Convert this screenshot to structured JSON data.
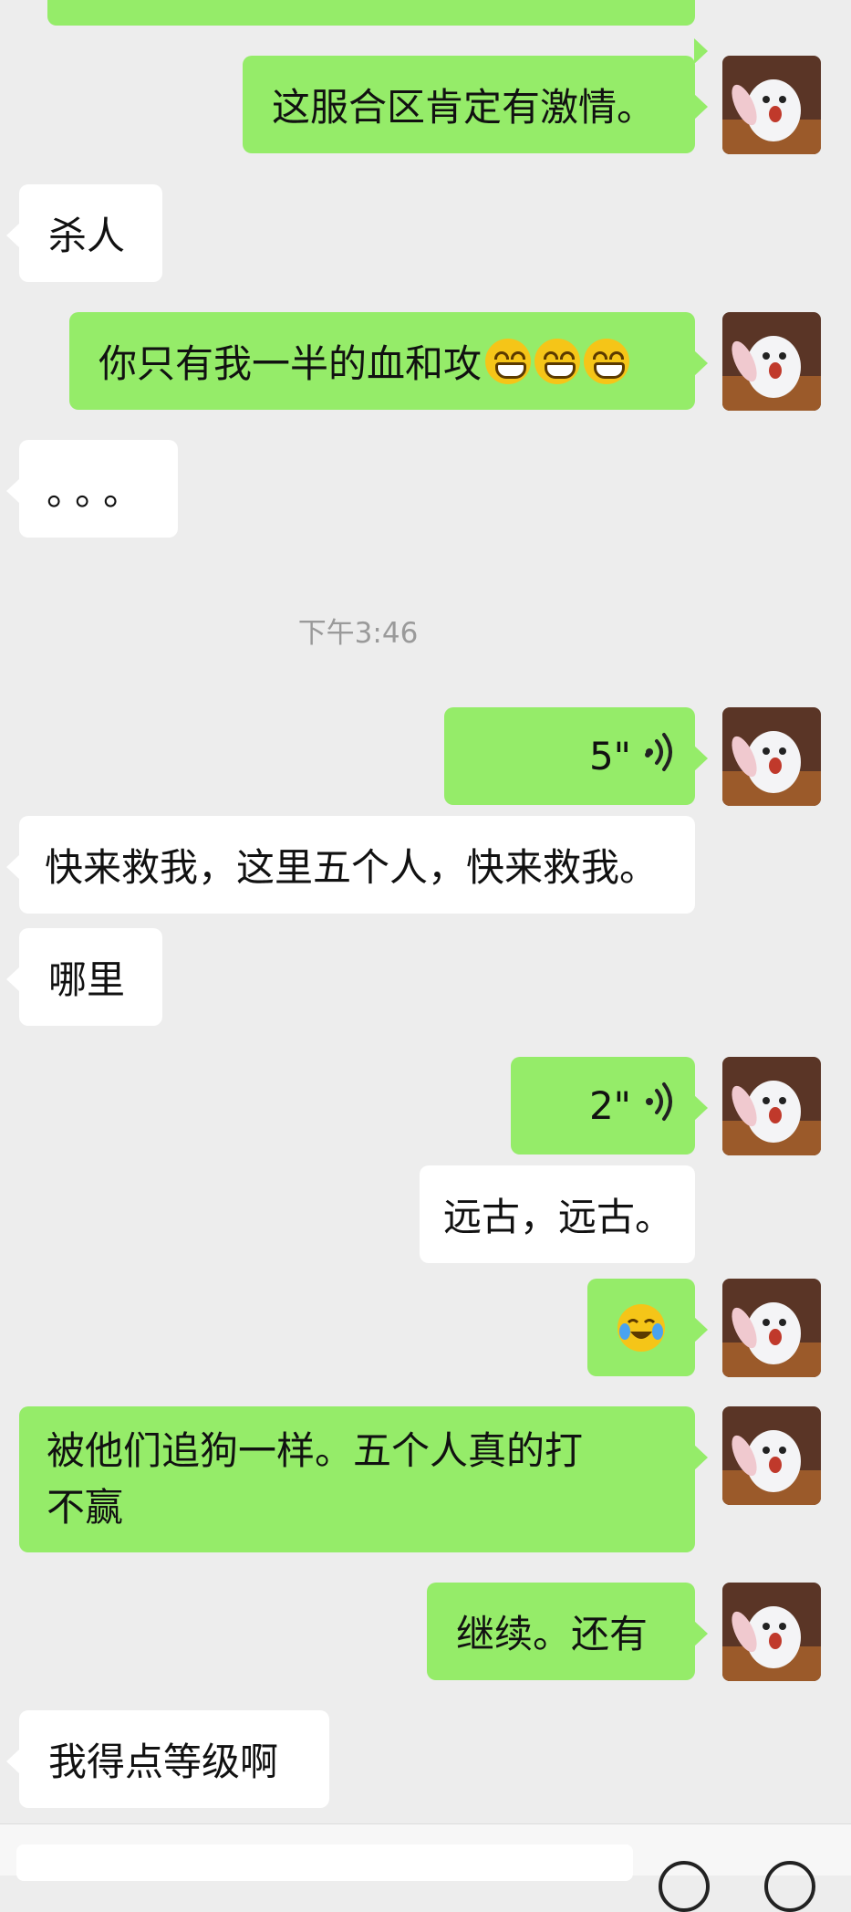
{
  "chat": {
    "timestamp": "下午3:46",
    "messages": [
      {
        "side": "me",
        "text": "这服合区肯定有激情。"
      },
      {
        "side": "other",
        "text": "杀人"
      },
      {
        "side": "me",
        "text": "你只有我一半的血和攻",
        "emoji": "grin-icon x3"
      },
      {
        "side": "other",
        "text": "。。。"
      },
      {
        "side": "me",
        "type": "voice",
        "duration": "5\""
      },
      {
        "side": "other",
        "text": "快来救我，这里五个人，快来救我。"
      },
      {
        "side": "other",
        "text": "哪里"
      },
      {
        "side": "me",
        "type": "voice",
        "duration": "2\""
      },
      {
        "side": "me",
        "text": "远古，远古。"
      },
      {
        "side": "me",
        "emoji": "crying-laughing-icon"
      },
      {
        "side": "me",
        "text": "被他们追狗一样。五个人真的打不赢"
      },
      {
        "side": "me",
        "text": "继续。还有"
      },
      {
        "side": "other",
        "text": "我得点等级啊"
      }
    ]
  },
  "colors": {
    "me_bubble": "#95ec69",
    "other_bubble": "#ffffff",
    "background": "#ededed"
  }
}
